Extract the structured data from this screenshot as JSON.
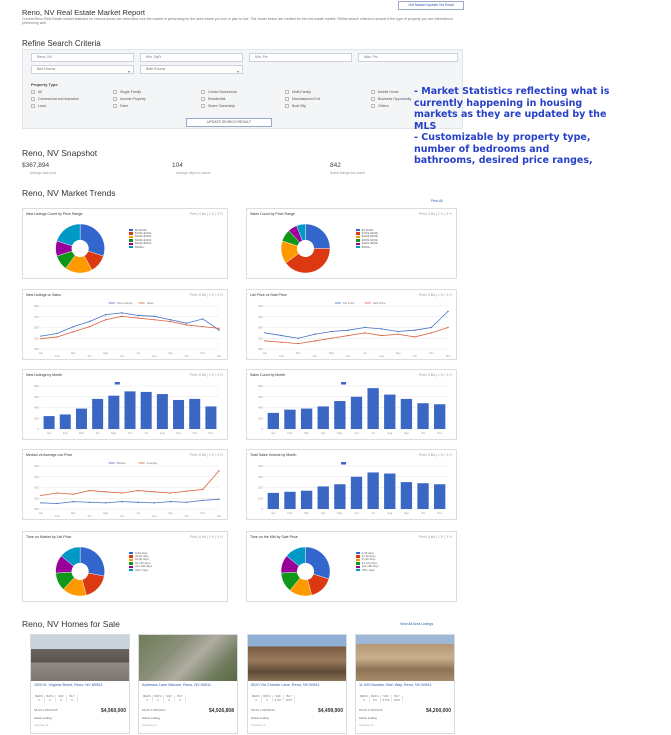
{
  "header": {
    "title": "Reno, NV Real Estate Market Report",
    "update_button": "Get Market Update Via Email",
    "intro": "Current Reno Real Estate market statistics for various areas can determine how the market is performing for the area where you live or plan to live. The charts below are created for the real estate market. Refine search criteria to answer if the type of property you are interested is performing well."
  },
  "refine": {
    "heading": "Refine Search Criteria",
    "city_value": "Reno, NV",
    "min_sqft_placeholder": "Min. SqFt",
    "min_price_placeholder": "Min. Prc",
    "max_price_placeholder": "Max. Prc",
    "beds_label": "Bed Rooms",
    "baths_label": "Bath Rooms",
    "property_type_label": "Property Type",
    "types": [
      "All",
      "Commercial and Industrial",
      "Land",
      "Single Family",
      "Income Property",
      "Farm",
      "Condo/Townhouse",
      "Residential",
      "Share Ownership",
      "Multi-Family",
      "Manufactured Full",
      "Boat Slip",
      "Mobile Home",
      "Business Opportunity",
      "Others"
    ],
    "update_button": "UPDATE SEARCH RESULT"
  },
  "annotation": {
    "line1": "- Market Statistics reflecting what is",
    "line2": "currently happening in housing",
    "line3": "markets as they are updated by the",
    "line4": "MLS",
    "line5": "- Customizable by property type,",
    "line6": "number of bedrooms and",
    "line7": "bathrooms, desired price ranges,"
  },
  "snapshot": {
    "heading": "Reno, NV Snapshot",
    "items": [
      {
        "value": "$367,894",
        "label": "Average sale price"
      },
      {
        "value": "104",
        "label": "Average days on market"
      },
      {
        "value": "842",
        "label": "Active listings this month"
      }
    ]
  },
  "trends": {
    "heading": "Reno, NV Market Trends",
    "print_all": "Print All",
    "tools": "Print | 6 Mo | 1 Yr | 3 Yr",
    "panels": [
      {
        "title": "New Listings Count by Price Range"
      },
      {
        "title": "Sales Count by Price Range"
      },
      {
        "title": "New Listings vs Sales"
      },
      {
        "title": "List Price vs Sale Price"
      },
      {
        "title": "New Listings by Month"
      },
      {
        "title": "Sales Count by Month"
      },
      {
        "title": "Median vs Average List Price"
      },
      {
        "title": "Total Sales Volume by Month"
      },
      {
        "title": "Time on Market by List Price"
      },
      {
        "title": "Time on the Mkt by Sale Price"
      }
    ]
  },
  "homes": {
    "heading": "Reno, NV Homes for Sale",
    "view_all": "View All Area Listings",
    "spec_labels": [
      "BEDS",
      "BATH",
      "SQF",
      "BLT"
    ],
    "listings": [
      {
        "address": "1000 N. Virginia Street, Reno, NV 89503",
        "specs": [
          "6",
          "6",
          "0",
          "0"
        ],
        "mls": "MLS# 170003015",
        "price": "$4,960,000",
        "status": "Active Listing",
        "courtesy": "Courtesy of ..."
      },
      {
        "address": "Addresss Lane Balcum, Reno, NV 89511",
        "specs": [
          "0",
          "0",
          "0",
          "0"
        ],
        "mls": "MLS# 170003112",
        "price": "$4,926,808",
        "status": "Active Listing",
        "courtesy": "Courtesy of ..."
      },
      {
        "address": "5020 Via Cherido Lane, Reno, NV 89511",
        "specs": [
          "4",
          "6",
          "8,347",
          "2007"
        ],
        "mls": "MLS# 170005015",
        "price": "$4,499,900",
        "status": "Active Listing",
        "courtesy": "Courtesy of ..."
      },
      {
        "address": "11 500 Boulder Glen Way, Reno, NV 89511",
        "specs": [
          "6",
          "5.5",
          "8,755",
          "2007"
        ],
        "mls": "MLS# 170003115",
        "price": "$4,200,000",
        "status": "Active Listing",
        "courtesy": "Courtesy of ..."
      }
    ]
  },
  "colors": {
    "accent": "#2d5aa8",
    "annotation": "#2740c8",
    "bar": "#3a66c4",
    "line_red": "#d9643f",
    "line_blue": "#4472c4"
  },
  "chart_data": [
    {
      "type": "pie",
      "title": "New Listings Count by Price Range",
      "labels": [
        "$0-$100k",
        "$100k-$200k",
        "$200k-$300k",
        "$300k-$400k",
        "$400k-$500k",
        "$500k+"
      ],
      "values": [
        30,
        12,
        18,
        10,
        10,
        20
      ],
      "colors": [
        "#3366cc",
        "#dc3912",
        "#ff9900",
        "#109618",
        "#990099",
        "#0099c6"
      ]
    },
    {
      "type": "pie",
      "title": "Sales Count by Price Range",
      "labels": [
        "$0-$100k",
        "$100k-$200k",
        "$200k-$300k",
        "$300k-$400k",
        "$400k-$500k",
        "$500k+"
      ],
      "values": [
        25,
        40,
        15,
        8,
        6,
        6
      ],
      "colors": [
        "#3366cc",
        "#dc3912",
        "#ff9900",
        "#109618",
        "#990099",
        "#0099c6"
      ]
    },
    {
      "type": "line",
      "title": "New Listings vs Sales",
      "x": [
        "Jan",
        "Feb",
        "Mar",
        "Apr",
        "May",
        "Jun",
        "Jul",
        "Aug",
        "Sep",
        "Oct",
        "Nov",
        "Dec"
      ],
      "series": [
        {
          "name": "New Listings",
          "values": [
            450,
            480,
            560,
            620,
            700,
            720,
            690,
            680,
            640,
            600,
            650,
            520
          ],
          "color": "#4472c4"
        },
        {
          "name": "Sales",
          "values": [
            420,
            440,
            500,
            560,
            640,
            680,
            660,
            640,
            620,
            580,
            560,
            540
          ],
          "color": "#d9643f"
        }
      ],
      "ylim": [
        300,
        800
      ]
    },
    {
      "type": "line",
      "title": "List Price vs Sale Price",
      "x": [
        "Jan",
        "Feb",
        "Mar",
        "Apr",
        "May",
        "Jun",
        "Jul",
        "Aug",
        "Sep",
        "Oct",
        "Nov",
        "Dec"
      ],
      "series": [
        {
          "name": "List Price",
          "values": [
            340,
            330,
            320,
            335,
            345,
            350,
            360,
            355,
            345,
            350,
            360,
            420
          ],
          "color": "#4472c4"
        },
        {
          "name": "Sale Price",
          "values": [
            310,
            305,
            300,
            310,
            320,
            330,
            340,
            330,
            335,
            325,
            340,
            360
          ],
          "color": "#d9643f"
        }
      ],
      "ylim": [
        280,
        440
      ]
    },
    {
      "type": "bar",
      "title": "New Listings by Month",
      "categories": [
        "Jan",
        "Feb",
        "Mar",
        "Apr",
        "May",
        "Jun",
        "Jul",
        "Aug",
        "Sep",
        "Oct",
        "Nov"
      ],
      "values": [
        240,
        270,
        380,
        560,
        620,
        700,
        690,
        650,
        540,
        560,
        420
      ],
      "ylim": [
        0,
        800
      ]
    },
    {
      "type": "bar",
      "title": "Sales Count by Month",
      "categories": [
        "Jan",
        "Feb",
        "Mar",
        "Apr",
        "May",
        "Jun",
        "Jul",
        "Aug",
        "Sep",
        "Oct",
        "Nov"
      ],
      "values": [
        300,
        360,
        380,
        420,
        520,
        600,
        760,
        640,
        560,
        480,
        460
      ],
      "ylim": [
        0,
        800
      ]
    },
    {
      "type": "line",
      "title": "Median vs Average List Price",
      "x": [
        "Jan",
        "Feb",
        "Mar",
        "Apr",
        "May",
        "Jun",
        "Jul",
        "Aug",
        "Sep",
        "Oct",
        "Nov",
        "Dec"
      ],
      "series": [
        {
          "name": "Median",
          "values": [
            300,
            295,
            310,
            305,
            300,
            310,
            305,
            300,
            310,
            305,
            320,
            330
          ],
          "color": "#4472c4"
        },
        {
          "name": "Average",
          "values": [
            360,
            380,
            370,
            400,
            390,
            380,
            400,
            390,
            380,
            395,
            410,
            560
          ],
          "color": "#d9643f"
        }
      ],
      "ylim": [
        250,
        600
      ]
    },
    {
      "type": "bar",
      "title": "Total Sales Volume by Month",
      "categories": [
        "Jan",
        "Feb",
        "Mar",
        "Apr",
        "May",
        "Jun",
        "Jul",
        "Aug",
        "Sep",
        "Oct",
        "Nov"
      ],
      "values": [
        150,
        160,
        170,
        210,
        230,
        300,
        340,
        330,
        250,
        240,
        230
      ],
      "ylim": [
        0,
        400
      ]
    },
    {
      "type": "pie",
      "title": "Time on Market by List Price",
      "labels": [
        "0-30 days",
        "31-60 days",
        "61-90 days",
        "91-120 days",
        "121-180 days",
        "180+ days"
      ],
      "values": [
        28,
        18,
        16,
        12,
        12,
        14
      ],
      "colors": [
        "#3366cc",
        "#dc3912",
        "#ff9900",
        "#109618",
        "#990099",
        "#0099c6"
      ]
    },
    {
      "type": "pie",
      "title": "Time on the Mkt by Sale Price",
      "labels": [
        "0-30 days",
        "31-60 days",
        "61-90 days",
        "91-120 days",
        "121-180 days",
        "180+ days"
      ],
      "values": [
        30,
        16,
        15,
        13,
        12,
        14
      ],
      "colors": [
        "#3366cc",
        "#dc3912",
        "#ff9900",
        "#109618",
        "#990099",
        "#0099c6"
      ]
    }
  ]
}
